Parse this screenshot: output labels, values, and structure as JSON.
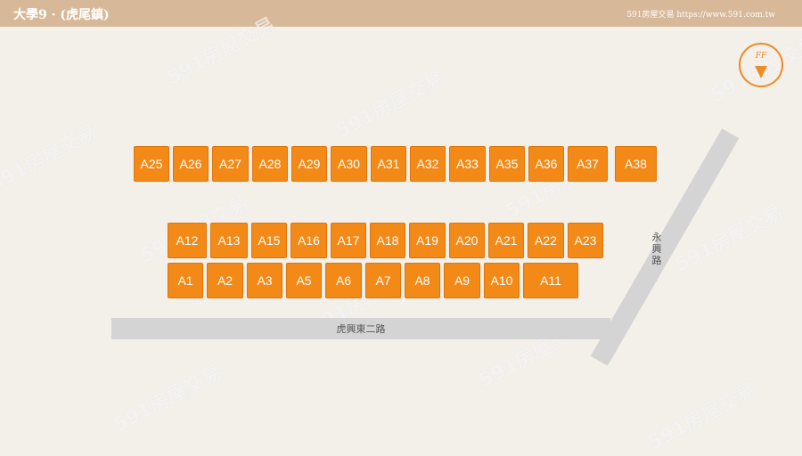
{
  "header": {
    "title": "大學9 · (虎尾鎮)",
    "brand": "591房屋交易 https://www.591.com.tw"
  },
  "compass": {
    "label": "FF"
  },
  "roads": {
    "horizontal": "虎興東二路",
    "diagonal": "永興路"
  },
  "lots": {
    "row_top": [
      "A25",
      "A26",
      "A27",
      "A28",
      "A29",
      "A30",
      "A31",
      "A32",
      "A33",
      "A35",
      "A36",
      "A37",
      "A38"
    ],
    "row_middle": [
      "A12",
      "A13",
      "A15",
      "A16",
      "A17",
      "A18",
      "A19",
      "A20",
      "A21",
      "A22",
      "A23"
    ],
    "row_bottom": [
      "A1",
      "A2",
      "A3",
      "A5",
      "A6",
      "A7",
      "A8",
      "A9",
      "A10",
      "A11"
    ]
  },
  "watermark": "591房屋交易",
  "colors": {
    "lot": "#f38a18",
    "header": "#d7b898",
    "road": "#d4d4d4",
    "background": "#f3efe9"
  }
}
